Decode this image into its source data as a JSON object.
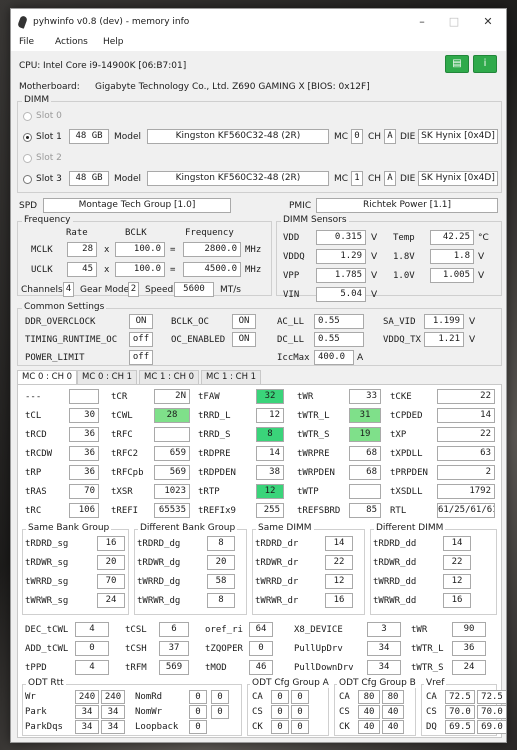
{
  "window": {
    "title": "pyhwinfo v0.8 (dev) - memory info"
  },
  "menu": [
    "File",
    "Actions",
    "Help"
  ],
  "cpu": {
    "label": "CPU:",
    "value": "Intel Core i9-14900K  [06:B7:01]"
  },
  "motherboard": {
    "label": "Motherboard:",
    "value": "Gigabyte Technology Co., Ltd. Z690 GAMING X  [BIOS: 0x12F]"
  },
  "dimm": {
    "group_label": "DIMM",
    "slots": [
      {
        "label": "Slot 0"
      },
      {
        "label": "Slot 1",
        "size": "48 GB",
        "model_label": "Model",
        "model": "Kingston  KF560C32-48  (2R)",
        "mc_label": "MC",
        "mc": "0",
        "ch_label": "CH",
        "ch": "A",
        "die_label": "DIE",
        "die": "SK Hynix [0x4D]"
      },
      {
        "label": "Slot 2"
      },
      {
        "label": "Slot 3",
        "size": "48 GB",
        "model_label": "Model",
        "model": "Kingston  KF560C32-48  (2R)",
        "mc_label": "MC",
        "mc": "1",
        "ch_label": "CH",
        "ch": "A",
        "die_label": "DIE",
        "die": "SK Hynix [0x4D]"
      }
    ]
  },
  "spd": {
    "label": "SPD",
    "value": "Montage Tech Group [1.0]"
  },
  "pmic": {
    "label": "PMIC",
    "value": "Richtek Power [1.1]"
  },
  "frequency": {
    "group_label": "Frequency",
    "headers": [
      "Rate",
      "BCLK",
      "Frequency"
    ],
    "mclk": {
      "label": "MCLK",
      "rate": "28",
      "x": "x",
      "bclk": "100.0",
      "eq": "=",
      "freq": "2800.0",
      "unit": "MHz"
    },
    "uclk": {
      "label": "UCLK",
      "rate": "45",
      "x": "x",
      "bclk": "100.0",
      "eq": "=",
      "freq": "4500.0",
      "unit": "MHz"
    },
    "channels_label": "Channels",
    "channels": "4",
    "gear_label": "Gear Mode",
    "gear": "2",
    "speed_label": "Speed",
    "speed": "5600",
    "speed_unit": "MT/s"
  },
  "sensors": {
    "group_label": "DIMM Sensors",
    "rows": [
      {
        "l1": "VDD",
        "v1": "0.315",
        "u1": "V",
        "l2": "Temp",
        "v2": "42.25",
        "u2": "°C"
      },
      {
        "l1": "VDDQ",
        "v1": "1.29",
        "u1": "V",
        "l2": "1.8V",
        "v2": "1.8",
        "u2": "V"
      },
      {
        "l1": "VPP",
        "v1": "1.785",
        "u1": "V",
        "l2": "1.0V",
        "v2": "1.005",
        "u2": "V"
      },
      {
        "l1": "VIN",
        "v1": "5.04",
        "u1": "V"
      }
    ]
  },
  "common": {
    "group_label": "Common Settings",
    "ddr_overclock": {
      "label": "DDR_OVERCLOCK",
      "value": "ON"
    },
    "bclk_oc": {
      "label": "BCLK_OC",
      "value": "ON"
    },
    "ac_ll": {
      "label": "AC_LL",
      "value": "0.55"
    },
    "sa_vid": {
      "label": "SA_VID",
      "value": "1.199",
      "unit": "V"
    },
    "timing_runtime": {
      "label": "TIMING_RUNTIME_OC",
      "value": "off"
    },
    "oc_enabled": {
      "label": "OC_ENABLED",
      "value": "ON"
    },
    "dc_ll": {
      "label": "DC_LL",
      "value": "0.55"
    },
    "vddq_tx": {
      "label": "VDDQ_TX",
      "value": "1.21",
      "unit": "V"
    },
    "power_limit": {
      "label": "POWER_LIMIT",
      "value": "off"
    },
    "iccmax": {
      "label": "IccMax",
      "value": "400.0",
      "unit": "A"
    }
  },
  "tabs": [
    "MC 0 : CH 0",
    "MC 0 : CH 1",
    "MC 1 : CH 0",
    "MC 1 : CH 1"
  ],
  "timings": [
    [
      {
        "l": "---",
        "v": ""
      },
      {
        "l": "tCR",
        "v": "2N"
      },
      {
        "l": "tFAW",
        "v": "32"
      },
      {
        "l": "tWR",
        "v": "33"
      },
      {
        "l": "tCKE",
        "v": "22"
      }
    ],
    [
      {
        "l": "tCL",
        "v": "30"
      },
      {
        "l": "tCWL",
        "v": "28"
      },
      {
        "l": "tRRD_L",
        "v": "12"
      },
      {
        "l": "tWTR_L",
        "v": "31"
      },
      {
        "l": "tCPDED",
        "v": "14"
      }
    ],
    [
      {
        "l": "tRCD",
        "v": "36"
      },
      {
        "l": "tRFC",
        "v": ""
      },
      {
        "l": "tRRD_S",
        "v": "8"
      },
      {
        "l": "tWTR_S",
        "v": "19"
      },
      {
        "l": "tXP",
        "v": "22"
      }
    ],
    [
      {
        "l": "tRCDW",
        "v": "36"
      },
      {
        "l": "tRFC2",
        "v": "659"
      },
      {
        "l": "tRDPRE",
        "v": "14"
      },
      {
        "l": "tWRPRE",
        "v": "68"
      },
      {
        "l": "tXPDLL",
        "v": "63"
      }
    ],
    [
      {
        "l": "tRP",
        "v": "36"
      },
      {
        "l": "tRFCpb",
        "v": "569"
      },
      {
        "l": "tRDPDEN",
        "v": "38"
      },
      {
        "l": "tWRPDEN",
        "v": "68"
      },
      {
        "l": "tPRPDEN",
        "v": "2"
      }
    ],
    [
      {
        "l": "tRAS",
        "v": "70"
      },
      {
        "l": "tXSR",
        "v": "1023"
      },
      {
        "l": "tRTP",
        "v": "12"
      },
      {
        "l": "tWTP",
        "v": ""
      },
      {
        "l": "tXSDLL",
        "v": "1792"
      }
    ],
    [
      {
        "l": "tRC",
        "v": "106"
      },
      {
        "l": "tREFI",
        "v": "65535"
      },
      {
        "l": "tREFIx9",
        "v": "255"
      },
      {
        "l": "tREFSBRD",
        "v": "85"
      },
      {
        "l": "RTL",
        "v": "61/25/61/61"
      }
    ]
  ],
  "bank": {
    "same_bank": {
      "label": "Same Bank Group",
      "rows": [
        {
          "l": "tRDRD_sg",
          "v": "16"
        },
        {
          "l": "tRDWR_sg",
          "v": "20"
        },
        {
          "l": "tWRRD_sg",
          "v": "70"
        },
        {
          "l": "tWRWR_sg",
          "v": "24"
        }
      ]
    },
    "diff_bank": {
      "label": "Different Bank Group",
      "rows": [
        {
          "l": "tRDRD_dg",
          "v": "8"
        },
        {
          "l": "tRDWR_dg",
          "v": "20"
        },
        {
          "l": "tWRRD_dg",
          "v": "58"
        },
        {
          "l": "tWRWR_dg",
          "v": "8"
        }
      ]
    },
    "same_dimm": {
      "label": "Same DIMM",
      "rows": [
        {
          "l": "tRDRD_dr",
          "v": "14"
        },
        {
          "l": "tRDWR_dr",
          "v": "22"
        },
        {
          "l": "tWRRD_dr",
          "v": "12"
        },
        {
          "l": "tWRWR_dr",
          "v": "16"
        }
      ]
    },
    "diff_dimm": {
      "label": "Different DIMM",
      "rows": [
        {
          "l": "tRDRD_dd",
          "v": "14"
        },
        {
          "l": "tRDWR_dd",
          "v": "22"
        },
        {
          "l": "tWRRD_dd",
          "v": "12"
        },
        {
          "l": "tWRWR_dd",
          "v": "16"
        }
      ]
    }
  },
  "misc": [
    [
      {
        "l": "DEC_tCWL",
        "v": "4"
      },
      {
        "l": "tCSL",
        "v": "6"
      },
      {
        "l": "oref_ri",
        "v": "64"
      },
      {
        "l": "X8_DEVICE",
        "v": "3"
      },
      {
        "l": "tWR",
        "v": "90"
      }
    ],
    [
      {
        "l": "ADD_tCWL",
        "v": "0"
      },
      {
        "l": "tCSH",
        "v": "37"
      },
      {
        "l": "tZQOPER",
        "v": "0"
      },
      {
        "l": "PullUpDrv",
        "v": "34"
      },
      {
        "l": "tWTR_L",
        "v": "36"
      }
    ],
    [
      {
        "l": "tPPD",
        "v": "4"
      },
      {
        "l": "tRFM",
        "v": "569"
      },
      {
        "l": "tMOD",
        "v": "46"
      },
      {
        "l": "PullDownDrv",
        "v": "34"
      },
      {
        "l": "tWTR_S",
        "v": "24"
      }
    ]
  ],
  "odt": {
    "group_label": "ODT Rtt",
    "rows": [
      {
        "l1": "Wr",
        "a": "240",
        "b": "240",
        "l2": "NomRd",
        "c": "0",
        "d": "0"
      },
      {
        "l1": "Park",
        "a": "34",
        "b": "34",
        "l2": "NomWr",
        "c": "0",
        "d": "0"
      },
      {
        "l1": "ParkDqs",
        "a": "34",
        "b": "34",
        "l2": "Loopback",
        "c": "0"
      }
    ]
  },
  "odt_a": {
    "group_label": "ODT Cfg Group A",
    "rows": [
      {
        "l": "CA",
        "a": "0",
        "b": "0"
      },
      {
        "l": "CS",
        "a": "0",
        "b": "0"
      },
      {
        "l": "CK",
        "a": "0",
        "b": "0"
      }
    ]
  },
  "odt_b": {
    "group_label": "ODT Cfg Group B",
    "rows": [
      {
        "l": "CA",
        "a": "80",
        "b": "80"
      },
      {
        "l": "CS",
        "a": "40",
        "b": "40"
      },
      {
        "l": "CK",
        "a": "40",
        "b": "40"
      }
    ]
  },
  "vref": {
    "group_label": "Vref",
    "rows": [
      {
        "l": "CA",
        "a": "72.5",
        "b": "72.5"
      },
      {
        "l": "CS",
        "a": "70.0",
        "b": "70.0"
      },
      {
        "l": "DQ",
        "a": "69.5",
        "b": "69.0"
      }
    ]
  }
}
